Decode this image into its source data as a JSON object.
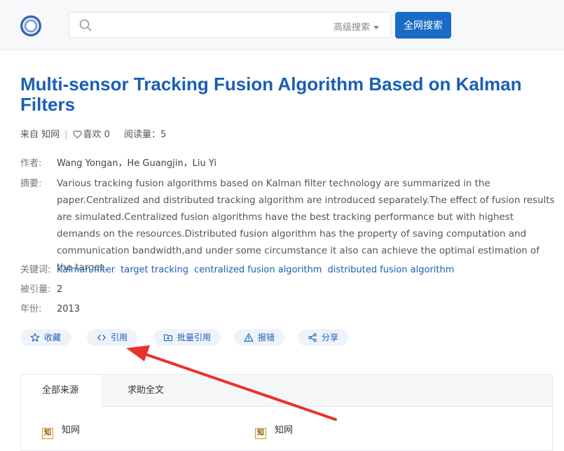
{
  "search": {
    "placeholder": "",
    "advanced_label": "高级搜索",
    "button_label": "全网搜索"
  },
  "article": {
    "title": "Multi-sensor Tracking Fusion Algorithm Based on Kalman Filters",
    "source_prefix": "来自 知网",
    "likes_label": "喜欢 0",
    "reads_label": "阅读量：5",
    "authors_label": "作者:",
    "authors": "Wang Yongan，He Guangjin，Liu Yi",
    "abstract_label": "摘要:",
    "abstract": "Various tracking fusion algorithms based on Kalman filter technology are summarized in the paper.Centralized and distributed tracking algorithm are introduced separately.The effect of fusion results are simulated.Centralized fusion algorithms have the best tracking performance but with highest demands on the resources.Distributed fusion algorithm has the property of saving computation and communication bandwidth,and under some circumstance it also can achieve the optimal estimation of the target.",
    "keywords_label": "关键词:",
    "keywords": [
      "Kalman filter",
      "target tracking",
      "centralized fusion algorithm",
      "distributed fusion algorithm"
    ],
    "cited_label": "被引量:",
    "cited": "2",
    "year_label": "年份:",
    "year": "2013"
  },
  "actions": {
    "favorite": "收藏",
    "cite": "引用",
    "batch_cite": "批量引用",
    "report": "报错",
    "share": "分享"
  },
  "sources": {
    "tabs": [
      "全部来源",
      "求助全文"
    ],
    "items": [
      {
        "logo": "知",
        "name": "知网"
      },
      {
        "logo": "知",
        "name": "知网"
      }
    ]
  },
  "colors": {
    "accent": "#1a6bc6",
    "link": "#1a5fb4",
    "annotation_arrow": "#e8322b"
  }
}
